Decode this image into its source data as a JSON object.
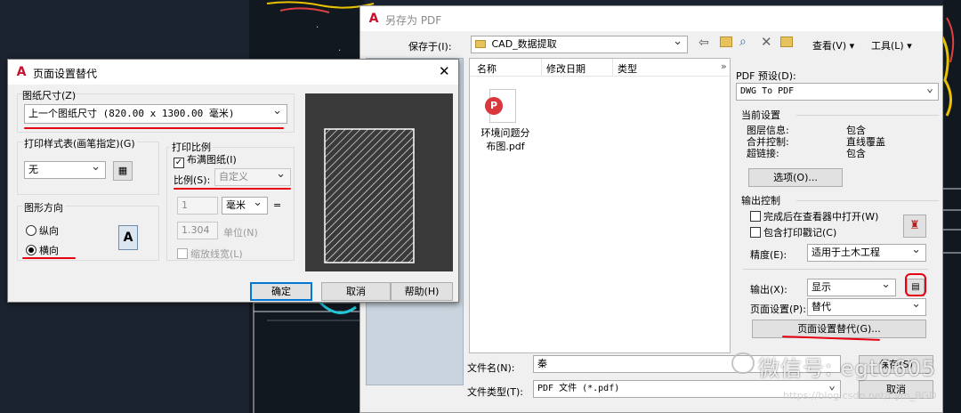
{
  "save_dialog": {
    "title": "另存为 PDF",
    "save_in_label": "保存于(I):",
    "save_in_value": "CAD_数据提取",
    "view_menu": "查看(V)",
    "tools_menu": "工具(L)",
    "columns": {
      "name": "名称",
      "date": "修改日期",
      "type": "类型"
    },
    "files": [
      {
        "name_line1": "环境问题分",
        "name_line2": "布图.pdf"
      }
    ],
    "preset_label": "PDF 预设(D):",
    "preset_value": "DWG To PDF",
    "current_settings": {
      "heading": "当前设置",
      "rows": [
        {
          "k": "图层信息:",
          "v": "包含"
        },
        {
          "k": "合并控制:",
          "v": "直线覆盖"
        },
        {
          "k": "超链接:",
          "v": "包含"
        }
      ],
      "options_button": "选项(O)..."
    },
    "output_control": {
      "heading": "输出控制",
      "open_in_viewer": "完成后在查看器中打开(W)",
      "include_plot_stamp": "包含打印戳记(C)",
      "precision_label": "精度(E):",
      "precision_value": "适用于土木工程",
      "output_label": "输出(X):",
      "output_value": "显示",
      "page_setup_label": "页面设置(P):",
      "page_setup_value": "替代",
      "page_setup_override_button": "页面设置替代(G)..."
    },
    "filename_label": "文件名(N):",
    "filename_value": "秦",
    "filetype_label": "文件类型(T):",
    "filetype_value": "PDF 文件 (*.pdf)",
    "save_button": "保存(S)",
    "cancel_button": "取消"
  },
  "page_setup_dialog": {
    "title": "页面设置替代",
    "paper_size_label": "图纸尺寸(Z)",
    "paper_size_value": "上一个图纸尺寸 (820.00 x 1300.00 毫米)",
    "plot_style_label": "打印样式表(画笔指定)(G)",
    "plot_style_value": "无",
    "plot_scale_label": "打印比例",
    "fit_to_paper": "布满图纸(I)",
    "scale_label": "比例(S):",
    "scale_value": "自定义",
    "scale_num": "1",
    "unit_value": "毫米",
    "scale_den": "1.304",
    "unit_label": "单位(N)",
    "scale_lineweights": "缩放线宽(L)",
    "orientation_label": "图形方向",
    "portrait": "纵向",
    "landscape": "横向",
    "ok_button": "确定",
    "cancel_button": "取消",
    "help_button": "帮助(H)"
  },
  "watermark": {
    "wechat_text": "微信号: egt0605",
    "url_text": "https://blog.csdn.net/Cym_BGD"
  },
  "colors": {
    "cad_bg": "#1c2330",
    "accent_red": "#e60012",
    "selection_blue": "#0078d7"
  }
}
